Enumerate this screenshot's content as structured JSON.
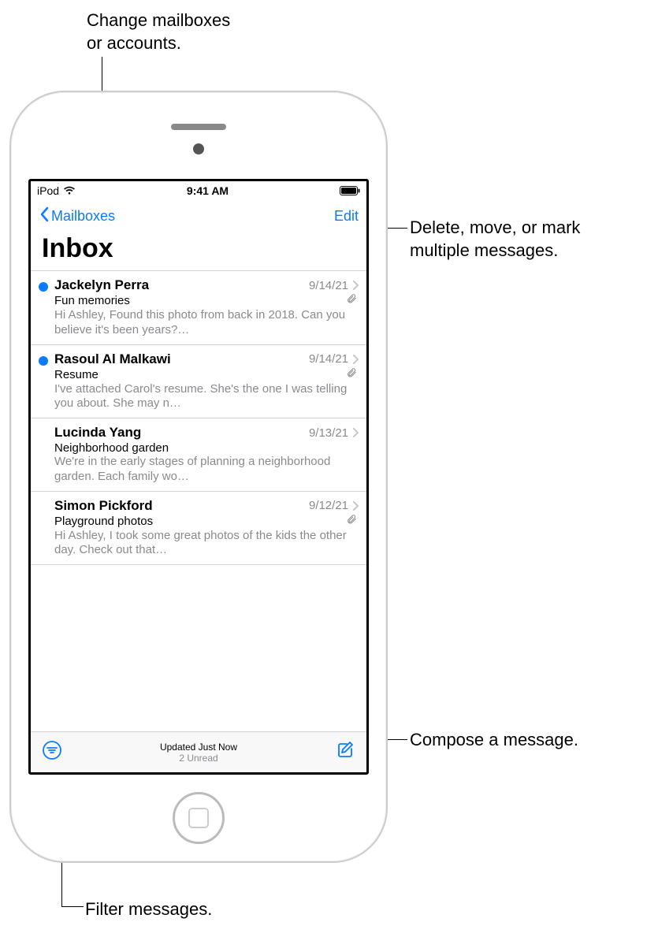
{
  "callouts": {
    "mailboxes": "Change mailboxes or accounts.",
    "edit": "Delete, move, or mark multiple messages.",
    "compose": "Compose a message.",
    "filter": "Filter messages."
  },
  "status": {
    "device": "iPod",
    "time": "9:41 AM"
  },
  "nav": {
    "back": "Mailboxes",
    "edit": "Edit",
    "title": "Inbox"
  },
  "messages": [
    {
      "sender": "Jackelyn Perra",
      "date": "9/14/21",
      "subject": "Fun memories",
      "preview": "Hi Ashley, Found this photo from back in 2018. Can you believe it's been years?…",
      "unread": true,
      "attachment": true
    },
    {
      "sender": "Rasoul Al Malkawi",
      "date": "9/14/21",
      "subject": "Resume",
      "preview": "I've attached Carol's resume. She's the one I was telling you about. She may n…",
      "unread": true,
      "attachment": true
    },
    {
      "sender": "Lucinda Yang",
      "date": "9/13/21",
      "subject": "Neighborhood garden",
      "preview": "We're in the early stages of planning a neighborhood garden. Each family wo…",
      "unread": false,
      "attachment": false
    },
    {
      "sender": "Simon Pickford",
      "date": "9/12/21",
      "subject": "Playground photos",
      "preview": "Hi Ashley, I took some great photos of the kids the other day. Check out that…",
      "unread": false,
      "attachment": true
    }
  ],
  "toolbar": {
    "updated": "Updated Just Now",
    "unread": "2 Unread"
  }
}
